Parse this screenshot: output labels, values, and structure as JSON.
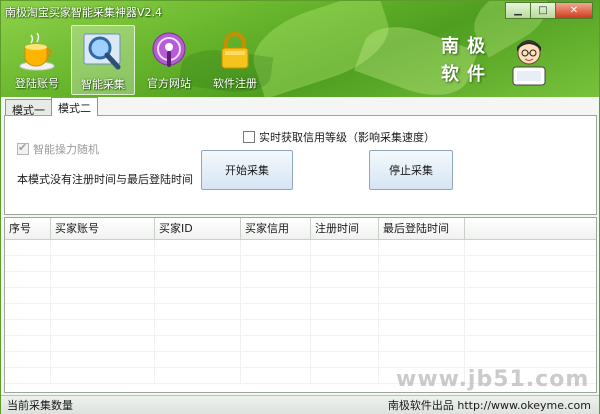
{
  "window": {
    "title": "南极淘宝买家智能采集神器V2.4",
    "controls": {
      "minimize": "▁",
      "maximize": "□",
      "close": "✕"
    }
  },
  "toolbar": {
    "items": [
      {
        "label": "登陆账号",
        "icon": "tea-cup-icon"
      },
      {
        "label": "智能采集",
        "icon": "magnifier-icon",
        "active": true
      },
      {
        "label": "官方网站",
        "icon": "podcast-icon"
      },
      {
        "label": "软件注册",
        "icon": "padlock-icon"
      }
    ]
  },
  "brand": {
    "line1": "南极",
    "line2": "软件"
  },
  "tabs": [
    {
      "label": "模式一",
      "active": false
    },
    {
      "label": "模式二",
      "active": true
    }
  ],
  "options": {
    "smart_random": {
      "label": "智能操力随机",
      "checked": true,
      "disabled": true
    },
    "realtime_credit": {
      "label": "实时获取信用等级（影响采集速度）",
      "checked": false
    }
  },
  "note": "本模式没有注册时间与最后登陆时间",
  "buttons": {
    "start": "开始采集",
    "stop": "停止采集"
  },
  "table": {
    "columns": [
      "序号",
      "买家账号",
      "买家ID",
      "买家信用",
      "注册时间",
      "最后登陆时间"
    ],
    "rows": []
  },
  "watermark": "www.jb51.com",
  "status": {
    "left": "当前采集数量",
    "right": "南极软件出品 http://www.okeyme.com"
  },
  "colors": {
    "banner": "#67b52c",
    "accent": "#5d9b2a"
  }
}
